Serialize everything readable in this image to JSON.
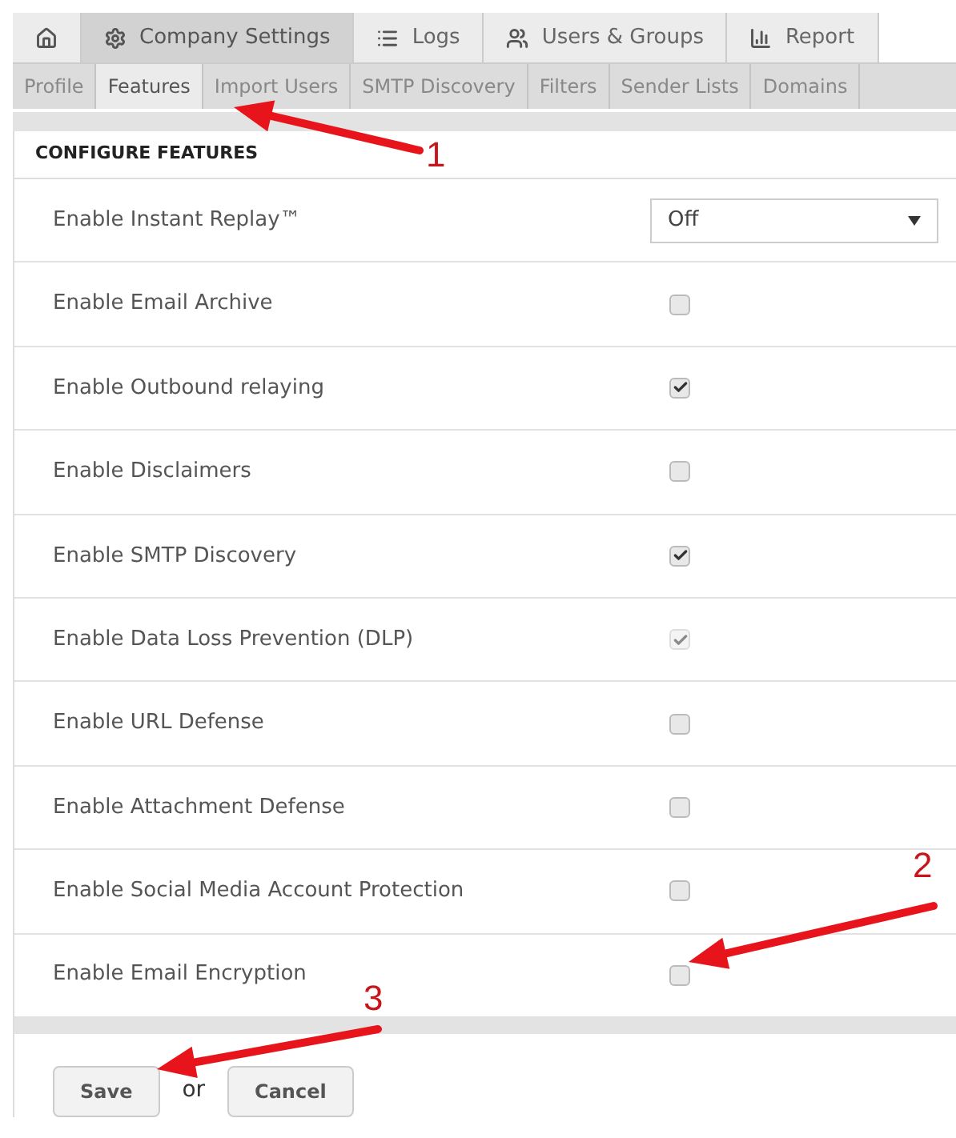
{
  "main_tabs": [
    {
      "kind": "home",
      "selected": false
    },
    {
      "kind": "gear",
      "label": "Company Settings",
      "selected": true
    },
    {
      "kind": "list",
      "label": "Logs",
      "selected": false
    },
    {
      "kind": "users",
      "label": "Users & Groups",
      "selected": false
    },
    {
      "kind": "chart",
      "label": "Report",
      "selected": false
    }
  ],
  "sub_tabs": [
    {
      "label": "Profile",
      "selected": false
    },
    {
      "label": "Features",
      "selected": true
    },
    {
      "label": "Import Users",
      "selected": false
    },
    {
      "label": "SMTP Discovery",
      "selected": false
    },
    {
      "label": "Filters",
      "selected": false
    },
    {
      "label": "Sender Lists",
      "selected": false
    },
    {
      "label": "Domains",
      "selected": false
    }
  ],
  "panel": {
    "title": "CONFIGURE FEATURES",
    "rows": [
      {
        "kind": "select",
        "label": "Enable Instant Replay™",
        "value": "Off"
      },
      {
        "kind": "checkbox",
        "label": "Enable Email Archive",
        "checked": false,
        "disabled": false
      },
      {
        "kind": "checkbox",
        "label": "Enable Outbound relaying",
        "checked": true,
        "disabled": false
      },
      {
        "kind": "checkbox",
        "label": "Enable Disclaimers",
        "checked": false,
        "disabled": false
      },
      {
        "kind": "checkbox",
        "label": "Enable SMTP Discovery",
        "checked": true,
        "disabled": false
      },
      {
        "kind": "checkbox",
        "label": "Enable Data Loss Prevention (DLP)",
        "checked": true,
        "disabled": true
      },
      {
        "kind": "checkbox",
        "label": "Enable URL Defense",
        "checked": false,
        "disabled": false
      },
      {
        "kind": "checkbox",
        "label": "Enable Attachment Defense",
        "checked": false,
        "disabled": false
      },
      {
        "kind": "checkbox",
        "label": "Enable Social Media Account Protection",
        "checked": false,
        "disabled": false
      },
      {
        "kind": "checkbox",
        "label": "Enable Email Encryption",
        "checked": false,
        "disabled": false
      }
    ]
  },
  "footer": {
    "save": "Save",
    "separator": "or",
    "cancel": "Cancel"
  },
  "annotations": [
    {
      "label": "1"
    },
    {
      "label": "2"
    },
    {
      "label": "3"
    }
  ]
}
